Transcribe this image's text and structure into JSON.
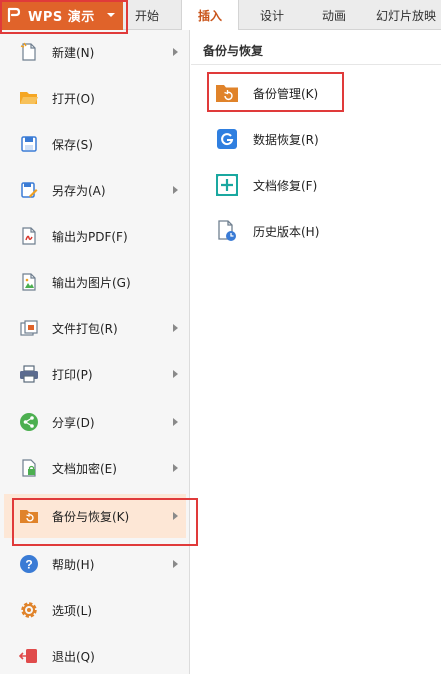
{
  "app_menu": {
    "title": "WPS 演示",
    "logo_icon": "wps-presentation-logo",
    "color": "#e0632a"
  },
  "tabs": [
    {
      "label": "开始"
    },
    {
      "label": "插入",
      "active": true
    },
    {
      "label": "设计"
    },
    {
      "label": "动画"
    },
    {
      "label": "幻灯片放映"
    }
  ],
  "menu": {
    "items": [
      {
        "label": "新建(N)",
        "icon": "new-file-icon",
        "has_submenu": true
      },
      {
        "label": "打开(O)",
        "icon": "open-folder-icon",
        "has_submenu": false
      },
      {
        "label": "保存(S)",
        "icon": "save-icon",
        "has_submenu": false
      },
      {
        "label": "另存为(A)",
        "icon": "save-as-icon",
        "has_submenu": true
      },
      {
        "label": "输出为PDF(F)",
        "icon": "export-pdf-icon",
        "has_submenu": false
      },
      {
        "label": "输出为图片(G)",
        "icon": "export-image-icon",
        "has_submenu": false
      },
      {
        "label": "文件打包(R)",
        "icon": "package-icon",
        "has_submenu": true
      },
      {
        "label": "打印(P)",
        "icon": "print-icon",
        "has_submenu": true
      },
      {
        "label": "分享(D)",
        "icon": "share-icon",
        "has_submenu": true
      },
      {
        "label": "文档加密(E)",
        "icon": "encrypt-icon",
        "has_submenu": true
      },
      {
        "label": "备份与恢复(K)",
        "icon": "backup-restore-icon",
        "has_submenu": true,
        "selected": true
      },
      {
        "label": "帮助(H)",
        "icon": "help-icon",
        "has_submenu": true
      },
      {
        "label": "选项(L)",
        "icon": "options-gear-icon",
        "has_submenu": false
      },
      {
        "label": "退出(Q)",
        "icon": "exit-icon",
        "has_submenu": false
      }
    ]
  },
  "submenu": {
    "title": "备份与恢复",
    "items": [
      {
        "label": "备份管理(K)",
        "icon": "backup-management-icon"
      },
      {
        "label": "数据恢复(R)",
        "icon": "data-recovery-icon"
      },
      {
        "label": "文档修复(F)",
        "icon": "document-repair-icon"
      },
      {
        "label": "历史版本(H)",
        "icon": "history-version-icon"
      }
    ]
  },
  "colors": {
    "accent": "#e0632a",
    "selected_bg": "#fde7d6",
    "highlight_box": "#e03a3a"
  }
}
